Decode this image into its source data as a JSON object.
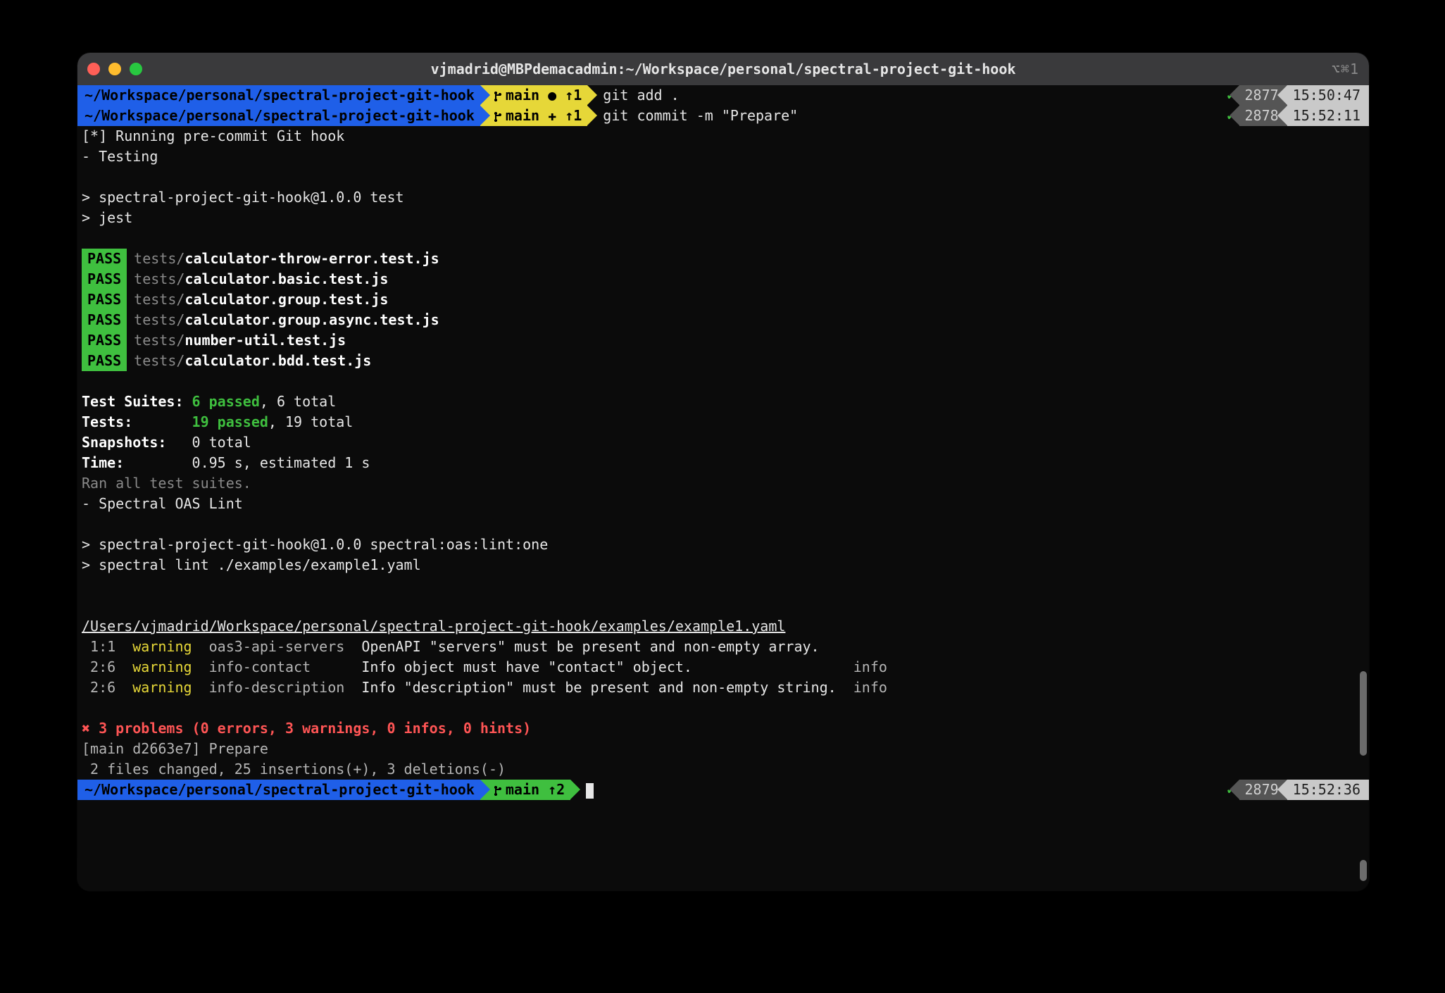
{
  "titlebar": {
    "title": "vjmadrid@MBPdemacadmin:~/Workspace/personal/spectral-project-git-hook",
    "right_label": "⌥⌘1"
  },
  "prompts": [
    {
      "path": "~/Workspace/personal/spectral-project-git-hook",
      "branch": "main",
      "branch_status": "● ↑1",
      "command": "git add .",
      "counter": "2877",
      "time": "15:50:47"
    },
    {
      "path": "~/Workspace/personal/spectral-project-git-hook",
      "branch": "main",
      "branch_status": "✚ ↑1",
      "command": "git commit -m \"Prepare\"",
      "counter": "2878",
      "time": "15:52:11"
    }
  ],
  "hook": {
    "running": "[*] Running pre-commit Git hook",
    "testing": "- Testing",
    "npm_test_1": "> spectral-project-git-hook@1.0.0 test",
    "npm_test_2": "> jest",
    "pass_label": "PASS",
    "tests": [
      {
        "dir": "tests/",
        "file": "calculator-throw-error.test.js"
      },
      {
        "dir": "tests/",
        "file": "calculator.basic.test.js"
      },
      {
        "dir": "tests/",
        "file": "calculator.group.test.js"
      },
      {
        "dir": "tests/",
        "file": "calculator.group.async.test.js"
      },
      {
        "dir": "tests/",
        "file": "number-util.test.js"
      },
      {
        "dir": "tests/",
        "file": "calculator.bdd.test.js"
      }
    ],
    "summary": {
      "suites_label": "Test Suites:",
      "suites_pass": "6 passed",
      "suites_total": ", 6 total",
      "tests_label": "Tests:      ",
      "tests_pass": "19 passed",
      "tests_total": ", 19 total",
      "snap_label": "Snapshots:  ",
      "snap_val": "0 total",
      "time_label": "Time:       ",
      "time_val": "0.95 s, estimated 1 s",
      "ran": "Ran all test suites."
    },
    "spectral_heading": "- Spectral OAS Lint",
    "npm_lint_1": "> spectral-project-git-hook@1.0.0 spectral:oas:lint:one",
    "npm_lint_2": "> spectral lint ./examples/example1.yaml",
    "lint_file": "/Users/vjmadrid/Workspace/personal/spectral-project-git-hook/examples/example1.yaml",
    "lint_rows": [
      {
        "loc": " 1:1",
        "sev": "warning",
        "rule": "oas3-api-servers",
        "msg": "OpenAPI \"servers\" must be present and non-empty array.",
        "path": ""
      },
      {
        "loc": " 2:6",
        "sev": "warning",
        "rule": "info-contact    ",
        "msg": "Info object must have \"contact\" object.                 ",
        "path": "info"
      },
      {
        "loc": " 2:6",
        "sev": "warning",
        "rule": "info-description",
        "msg": "Info \"description\" must be present and non-empty string.",
        "path": "info"
      }
    ],
    "problems": "✖ 3 problems (0 errors, 3 warnings, 0 infos, 0 hints)",
    "commit_1": "[main d2663e7] Prepare",
    "commit_2": " 2 files changed, 25 insertions(+), 3 deletions(-)"
  },
  "final_prompt": {
    "path": "~/Workspace/personal/spectral-project-git-hook",
    "branch": "main",
    "branch_status": "↑2",
    "counter": "2879",
    "time": "15:52:36"
  },
  "check": "✔"
}
